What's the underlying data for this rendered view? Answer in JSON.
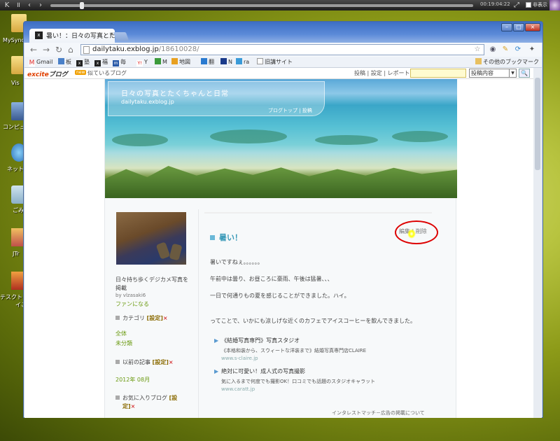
{
  "player": {
    "time": "00:19:04:22",
    "hide_label": "非表示"
  },
  "desktop": {
    "icons": [
      {
        "label": "MySync"
      },
      {
        "label": "Vis"
      },
      {
        "label": "コンピュ"
      },
      {
        "label": "ネット"
      },
      {
        "label": "ごみ"
      },
      {
        "label": "JTr"
      },
      {
        "label": "テスクト"
      },
      {
        "label": "イこ"
      }
    ]
  },
  "browser": {
    "tab_title": "暑い！：日々の写真とたくちゃ",
    "url_host": "dailytaku.exblog.jp",
    "url_path": "/18610028/",
    "bookmarks": [
      "Gmail",
      "板",
      "塾",
      "福",
      "毎",
      "Y",
      "M",
      "地図",
      "翻",
      "N",
      "ra",
      "旧講サイト"
    ],
    "other_bookmarks": "その他のブックマーク"
  },
  "excite": {
    "logo": "excite",
    "logo_suffix": "ブログ",
    "new_badge": "new",
    "fav_blogs": "似ているブログ",
    "links": "投稿 | 設定 | レポート",
    "search_select": "投稿内容",
    "search_btn": "🔍"
  },
  "blog": {
    "title": "日々の写真とたくちゃんと日常",
    "url": "dailytaku.exblog.jp",
    "header_links": "ブログトップ | 投稿",
    "sidebar": {
      "desc_line1": "日々持ち歩くデジカメ写真を",
      "desc_line2": "掲載",
      "by": "by vlzasaki6",
      "fan": "ファンになる",
      "category_label": "カテゴリ",
      "setting_tag": "[設定]",
      "x": "×",
      "cat_all": "全体",
      "cat_none": "未分類",
      "archive_label": "以前の記事",
      "archive_item": "2012年 08月",
      "fav_label": "お気に入りブログ",
      "fav_tag_a": "[設",
      "fav_tag_b": "定]"
    },
    "post": {
      "title": "暑い！",
      "actions": "編集 | 削除",
      "p1": "暑いですねぇ。。。。。。",
      "p2": "午前中は曇り、お昼ころに豪雨、午後は猛暑、、、",
      "p3": "一日で何通りもの夏を感じることができました。ハイ。",
      "p4": "ってことで、いかにも涼しげな近くのカフェでアイスコーヒーを飲んできました。"
    },
    "ads": [
      {
        "title": "《結婚写真専門》写真スタジオ",
        "desc": "《本格和装から、スウィートな洋装まで》結婚写真専門店CLAIRE",
        "url": "www.s-claire.jp"
      },
      {
        "title": "絶対に可愛い！成人式の写真撮影",
        "desc": "気に入るまで何度でも撮影OK！口コミでも話題のスタジオキャラット",
        "url": "www.caratt.jp"
      }
    ],
    "ad_note": "インタレストマッチ－広告の掲載について"
  }
}
